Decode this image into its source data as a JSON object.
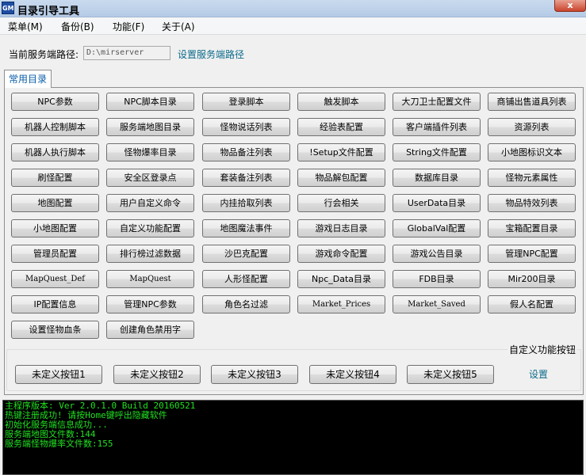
{
  "window": {
    "title": "目录引导工具",
    "icon_text": "GM",
    "close_label": "x"
  },
  "menu": [
    "菜单(M)",
    "备份(B)",
    "功能(F)",
    "关于(A)"
  ],
  "server": {
    "label": "当前服务端路径:",
    "path_value": "D:\\mirserver",
    "set_link": "设置服务端路径"
  },
  "tab": {
    "label": "常用目录"
  },
  "grid_buttons": [
    [
      "NPC参数",
      "NPC脚本目录",
      "登录脚本",
      "触发脚本",
      "大刀卫士配置文件",
      "商铺出售道具列表"
    ],
    [
      "机器人控制脚本",
      "服务端地图目录",
      "怪物说话列表",
      "经验表配置",
      "客户端插件列表",
      "资源列表"
    ],
    [
      "机器人执行脚本",
      "怪物爆率目录",
      "物品备注列表",
      "!Setup文件配置",
      "String文件配置",
      "小地图标识文本"
    ],
    [
      "刷怪配置",
      "安全区登录点",
      "套装备注列表",
      "物品解包配置",
      "数据库目录",
      "怪物元素属性"
    ],
    [
      "地图配置",
      "用户自定义命令",
      "内挂拾取列表",
      "行会相关",
      "UserData目录",
      "物品特效列表"
    ],
    [
      "小地图配置",
      "自定义功能配置",
      "地图魔法事件",
      "游戏日志目录",
      "GlobalVal配置",
      "宝箱配置目录"
    ],
    [
      "管理员配置",
      "排行榜过滤数据",
      "沙巴克配置",
      "游戏命令配置",
      "游戏公告目录",
      "管理NPC配置"
    ],
    [
      "MapQuest_Def",
      "MapQuest",
      "人形怪配置",
      "Npc_Data目录",
      "FDB目录",
      "Mir200目录"
    ],
    [
      "IP配置信息",
      "管理NPC参数",
      "角色名过滤",
      "Market_Prices",
      "Market_Saved",
      "假人名配置"
    ],
    [
      "设置怪物血条",
      "创建角色禁用字"
    ]
  ],
  "custom": {
    "label": "自定义功能按钮",
    "buttons": [
      "未定义按钮1",
      "未定义按钮2",
      "未定义按钮3",
      "未定义按钮4",
      "未定义按钮5"
    ],
    "settings_label": "设置"
  },
  "console_lines": [
    "主程序版本: Ver 2.0.1.0 Build 20160521",
    "热键注册成功! 请按Home键呼出隐藏软件",
    "初始化服务端信息成功...",
    "服务端地图文件数:144",
    "服务端怪物爆率文件数:155"
  ],
  "colors": {
    "console_text": "#21e021",
    "link": "#0b6b8a",
    "tab_text": "#0a5ea8"
  }
}
